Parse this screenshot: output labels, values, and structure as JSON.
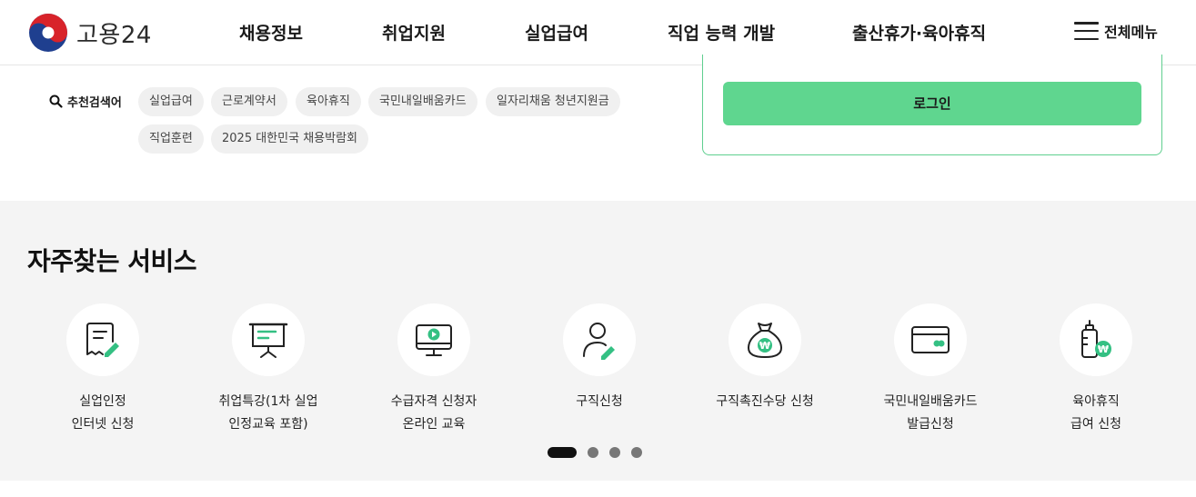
{
  "header": {
    "logo_text": "고용24",
    "nav": [
      "채용정보",
      "취업지원",
      "실업급여",
      "직업 능력 개발",
      "출산휴가·육아휴직"
    ],
    "all_menu_label": "전체메뉴"
  },
  "search": {
    "recommended_label": "추천검색어",
    "keywords": [
      "실업급여",
      "근로계약서",
      "육아휴직",
      "국민내일배움카드",
      "일자리채움 청년지원금",
      "직업훈련",
      "2025 대한민국 채용박람회"
    ]
  },
  "login": {
    "button_label": "로그인"
  },
  "services": {
    "title": "자주찾는 서비스",
    "items": [
      {
        "label": "실업인정\n인터넷 신청",
        "icon": "document-edit-icon"
      },
      {
        "label": "취업특강(1차 실업\n인정교육 포함)",
        "icon": "presentation-board-icon"
      },
      {
        "label": "수급자격 신청자\n온라인 교육",
        "icon": "monitor-play-icon"
      },
      {
        "label": "구직신청",
        "icon": "person-edit-icon"
      },
      {
        "label": "구직촉진수당 신청",
        "icon": "money-bag-icon"
      },
      {
        "label": "국민내일배움카드\n발급신청",
        "icon": "card-icon"
      },
      {
        "label": "육아휴직\n급여 신청",
        "icon": "baby-bottle-icon"
      }
    ],
    "pagination": {
      "total": 4,
      "current": 1
    }
  },
  "colors": {
    "accent": "#5fd68f",
    "accent_border": "#5fcf8f",
    "section_bg": "#f4f4f4"
  }
}
